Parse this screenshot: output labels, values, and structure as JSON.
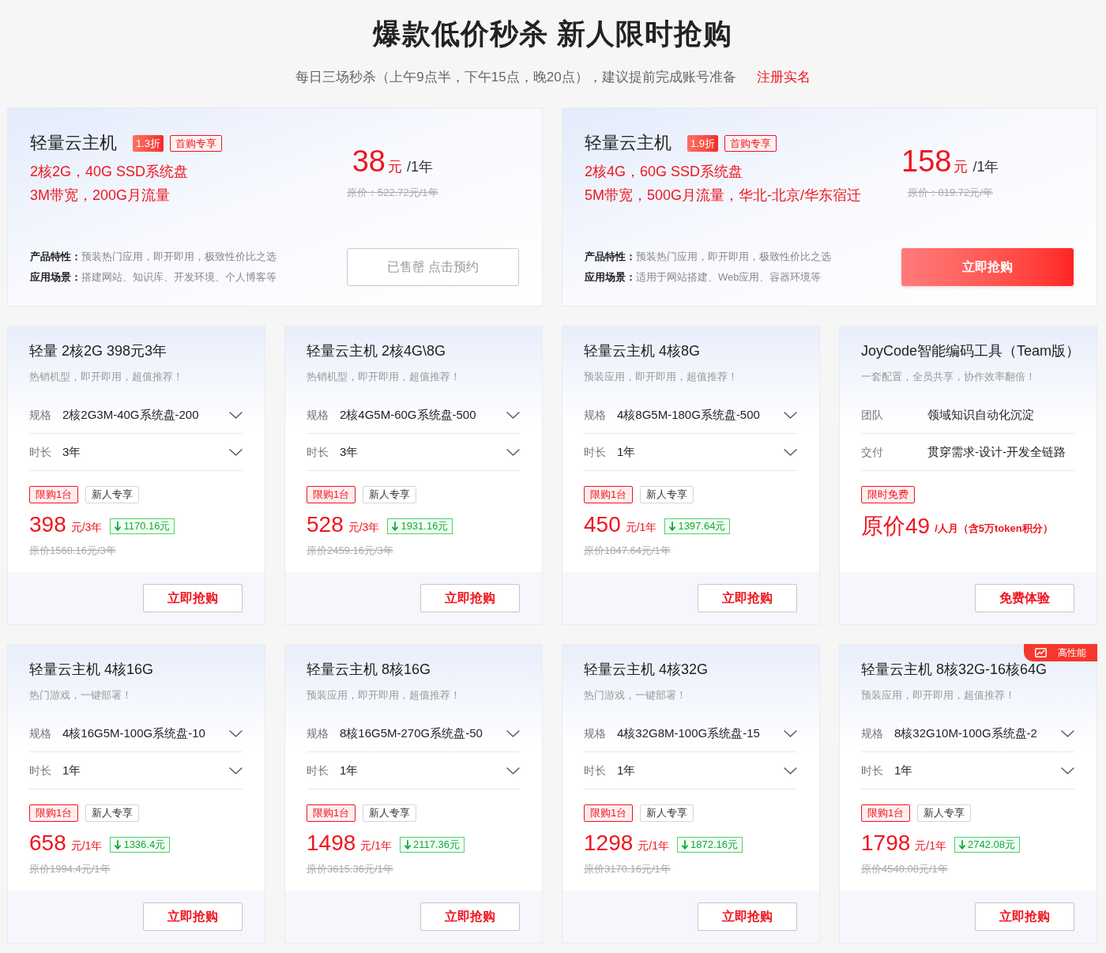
{
  "header": {
    "title": "爆款低价秒杀 新人限时抢购",
    "subtitle": "每日三场秒杀（上午9点半，下午15点，晚20点），建议提前完成账号准备",
    "link": "注册实名"
  },
  "featured": [
    {
      "title": "轻量云主机",
      "discount": "1.3折",
      "tag": "首购专享",
      "specs": [
        "2核2G，40G SSD系统盘",
        "3M带宽，200G月流量"
      ],
      "price": "38",
      "currency": "元",
      "period": "/1年",
      "original_price": "原价：522.72元/1年",
      "features": [
        {
          "label": "产品特性：",
          "text": "预装热门应用，即开即用，极致性价比之选"
        },
        {
          "label": "应用场景：",
          "text": "搭建网站、知识库、开发环境、个人博客等"
        }
      ],
      "button": {
        "label": "已售罄 点击预约",
        "disabled": true
      }
    },
    {
      "title": "轻量云主机",
      "discount": "1.9折",
      "tag": "首购专享",
      "specs": [
        "2核4G，60G SSD系统盘",
        "5M带宽，500G月流量，华北-北京/华东宿迁"
      ],
      "price": "158",
      "currency": "元",
      "period": "/1年",
      "original_price": "原价：819.72元/年",
      "features": [
        {
          "label": "产品特性：",
          "text": "预装热门应用，即开即用，极致性价比之选"
        },
        {
          "label": "应用场景：",
          "text": "适用于网站搭建、Web应用、容器环境等"
        }
      ],
      "button": {
        "label": "立即抢购",
        "disabled": false
      }
    }
  ],
  "products": [
    {
      "kind": "server",
      "title": "轻量 2核2G 398元3年",
      "subtitle": "热销机型，即开即用，超值推荐！",
      "options": [
        {
          "label": "规格",
          "value": "2核2G3M-40G系统盘-200"
        },
        {
          "label": "时长",
          "value": "3年"
        }
      ],
      "tags": [
        {
          "label": "限购1台",
          "kind": "highlight"
        },
        {
          "label": "新人专享",
          "kind": "plain"
        }
      ],
      "price": "398",
      "unit": "元/3年",
      "saving": "1170.16元",
      "original_price": "原价1568.16元/3年",
      "button": "立即抢购"
    },
    {
      "kind": "server",
      "title": "轻量云主机 2核4G\\8G",
      "subtitle": "热销机型，即开即用，超值推荐！",
      "options": [
        {
          "label": "规格",
          "value": "2核4G5M-60G系统盘-500"
        },
        {
          "label": "时长",
          "value": "3年"
        }
      ],
      "tags": [
        {
          "label": "限购1台",
          "kind": "highlight"
        },
        {
          "label": "新人专享",
          "kind": "plain"
        }
      ],
      "price": "528",
      "unit": "元/3年",
      "saving": "1931.16元",
      "original_price": "原价2459.16元/3年",
      "button": "立即抢购"
    },
    {
      "kind": "server",
      "title": "轻量云主机 4核8G",
      "subtitle": "预装应用，即开即用，超值推荐！",
      "options": [
        {
          "label": "规格",
          "value": "4核8G5M-180G系统盘-500"
        },
        {
          "label": "时长",
          "value": "1年"
        }
      ],
      "tags": [
        {
          "label": "限购1台",
          "kind": "highlight"
        },
        {
          "label": "新人专享",
          "kind": "plain"
        }
      ],
      "price": "450",
      "unit": "元/1年",
      "saving": "1397.64元",
      "original_price": "原价1847.64元/1年",
      "button": "立即抢购"
    },
    {
      "kind": "tool",
      "title": "JoyCode智能编码工具（Team版）",
      "subtitle": "一套配置，全员共享，协作效率翻倍！",
      "options": [
        {
          "label": "团队",
          "value": "领域知识自动化沉淀"
        },
        {
          "label": "交付",
          "value": "贯穿需求-设计-开发全链路"
        }
      ],
      "tags": [
        {
          "label": "限时免费",
          "kind": "highlight"
        }
      ],
      "price": "原价49",
      "unit": "/人月（含5万token积分）",
      "button": "免费体验"
    },
    {
      "kind": "server",
      "title": "轻量云主机 4核16G",
      "subtitle": "热门游戏，一键部署！",
      "options": [
        {
          "label": "规格",
          "value": "4核16G5M-100G系统盘-10"
        },
        {
          "label": "时长",
          "value": "1年"
        }
      ],
      "tags": [
        {
          "label": "限购1台",
          "kind": "highlight"
        },
        {
          "label": "新人专享",
          "kind": "plain"
        }
      ],
      "price": "658",
      "unit": "元/1年",
      "saving": "1336.4元",
      "original_price": "原价1994.4元/1年",
      "button": "立即抢购"
    },
    {
      "kind": "server",
      "title": "轻量云主机 8核16G",
      "subtitle": "预装应用，即开即用，超值推荐！",
      "options": [
        {
          "label": "规格",
          "value": "8核16G5M-270G系统盘-50"
        },
        {
          "label": "时长",
          "value": "1年"
        }
      ],
      "tags": [
        {
          "label": "限购1台",
          "kind": "highlight"
        },
        {
          "label": "新人专享",
          "kind": "plain"
        }
      ],
      "price": "1498",
      "unit": "元/1年",
      "saving": "2117.36元",
      "original_price": "原价3615.36元/1年",
      "button": "立即抢购"
    },
    {
      "kind": "server",
      "title": "轻量云主机 4核32G",
      "subtitle": "热门游戏，一键部署！",
      "options": [
        {
          "label": "规格",
          "value": "4核32G8M-100G系统盘-15"
        },
        {
          "label": "时长",
          "value": "1年"
        }
      ],
      "tags": [
        {
          "label": "限购1台",
          "kind": "highlight"
        },
        {
          "label": "新人专享",
          "kind": "plain"
        }
      ],
      "price": "1298",
      "unit": "元/1年",
      "saving": "1872.16元",
      "original_price": "原价3170.16元/1年",
      "button": "立即抢购"
    },
    {
      "kind": "server",
      "ribbon": "高性能",
      "title": "轻量云主机 8核32G-16核64G",
      "subtitle": "预装应用，即开即用，超值推荐！",
      "options": [
        {
          "label": "规格",
          "value": "8核32G10M-100G系统盘-2"
        },
        {
          "label": "时长",
          "value": "1年"
        }
      ],
      "tags": [
        {
          "label": "限购1台",
          "kind": "highlight"
        },
        {
          "label": "新人专享",
          "kind": "plain"
        }
      ],
      "price": "1798",
      "unit": "元/1年",
      "saving": "2742.08元",
      "original_price": "原价4540.08元/1年",
      "button": "立即抢购"
    }
  ]
}
